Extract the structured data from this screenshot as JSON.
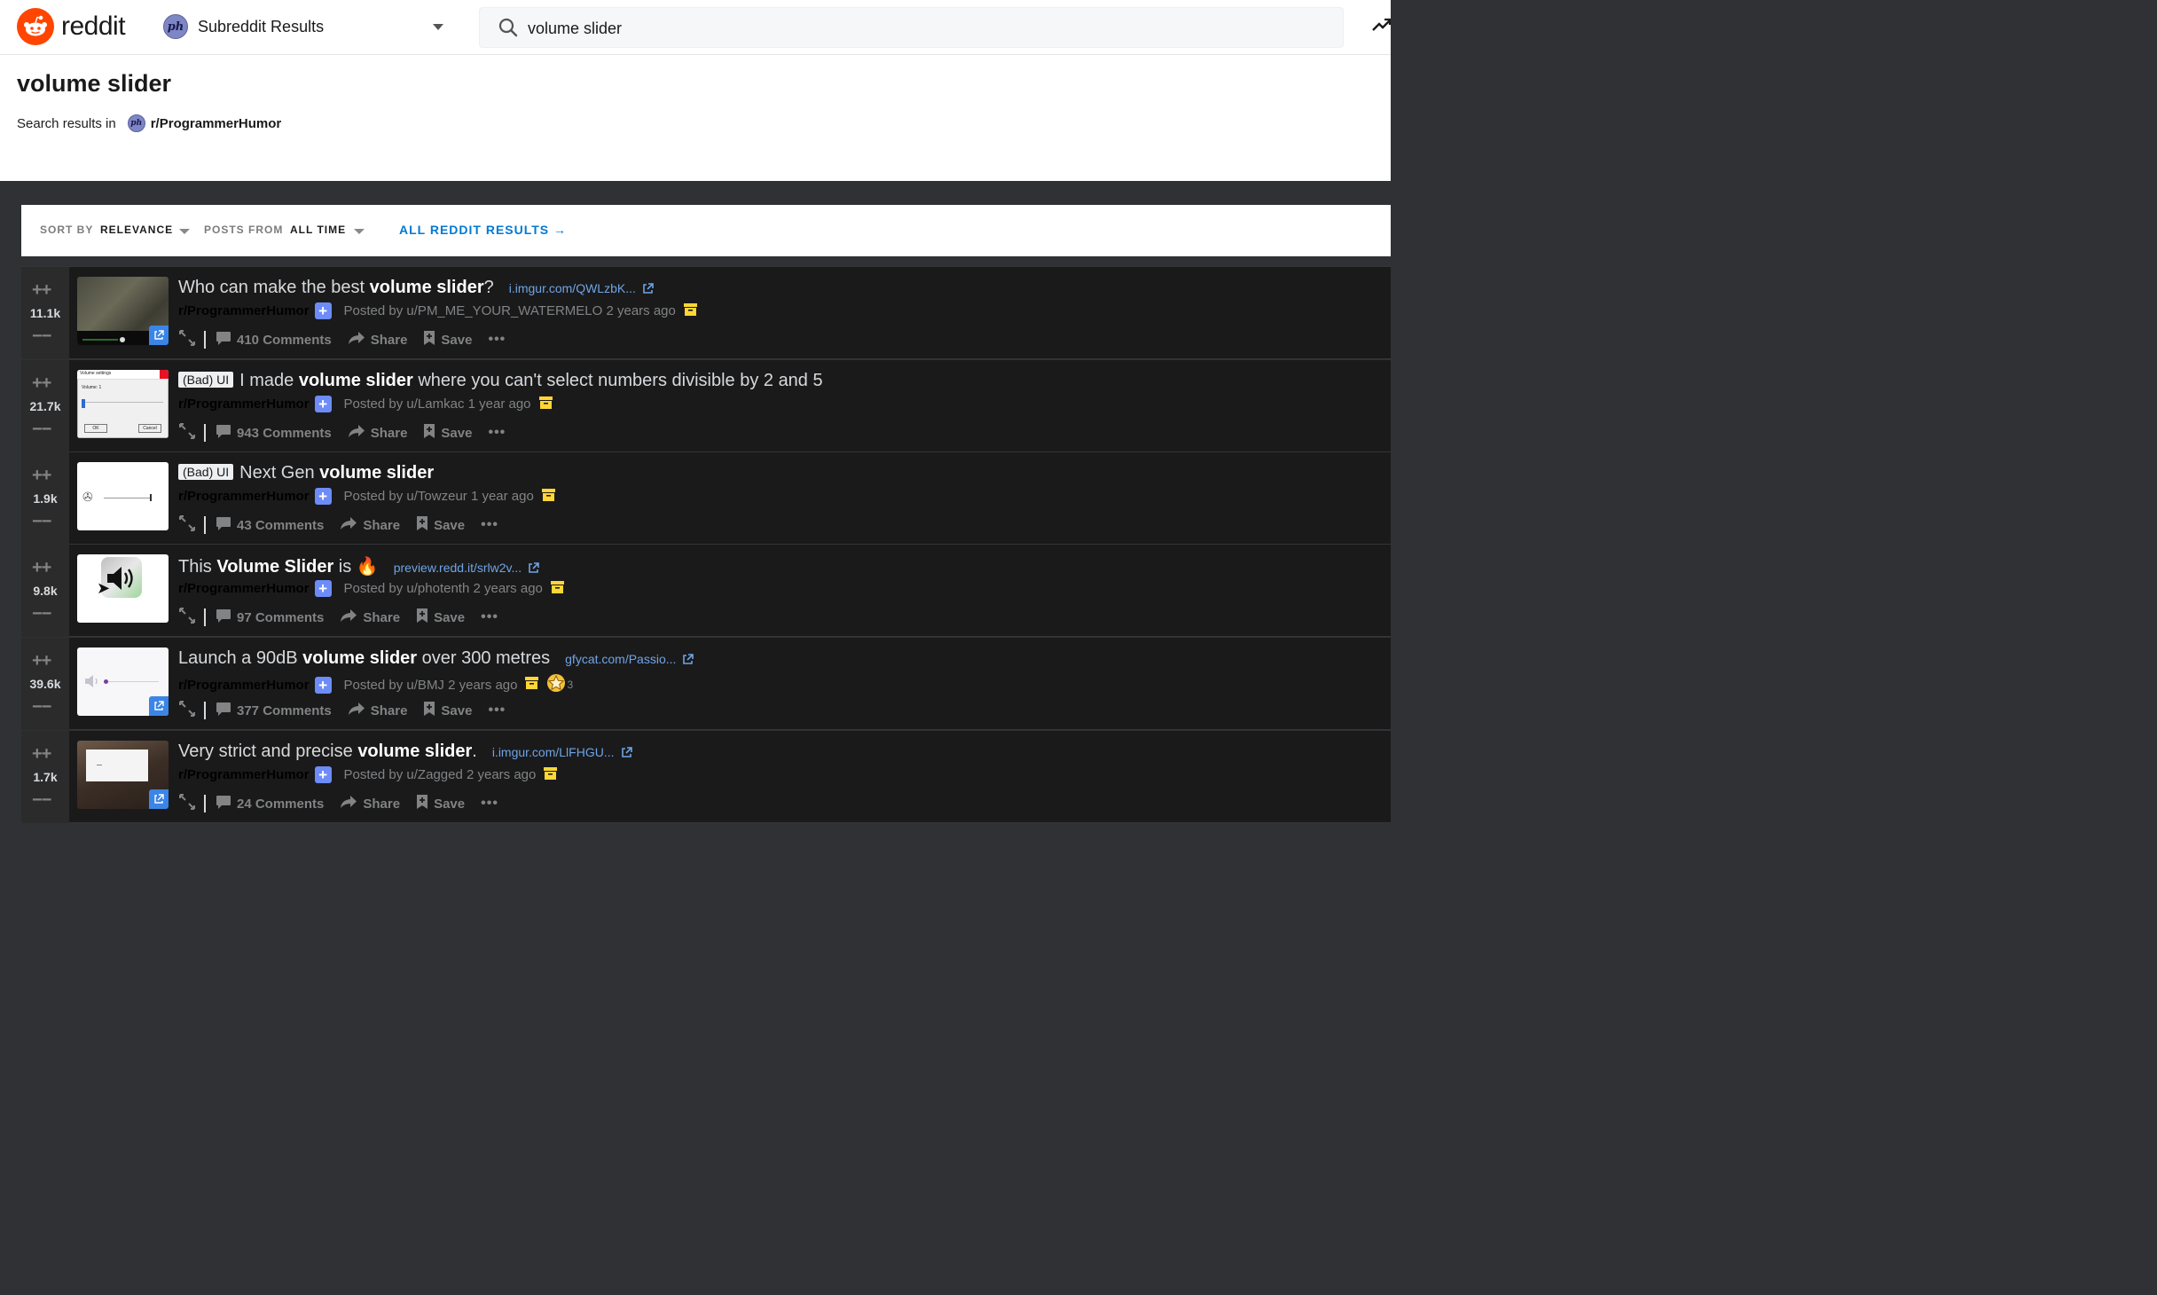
{
  "topbar": {
    "logo_text": "reddit",
    "community_avatar": "ph",
    "community_label": "Subreddit Results",
    "search_value": "volume slider",
    "search_icon": "magnifier",
    "trending_icon": "trending-up"
  },
  "header": {
    "title": "volume slider",
    "results_in_label": "Search results in",
    "subreddit_avatar": "ph",
    "subreddit": "r/ProgrammerHumor"
  },
  "filters": {
    "sort_label": "SORT BY",
    "sort_value": "RELEVANCE",
    "posts_from_label": "POSTS FROM",
    "posts_from_value": "ALL TIME",
    "all_results_link": "ALL REDDIT RESULTS →"
  },
  "colors": {
    "brand": "#ff4500",
    "link": "#0079d3",
    "join": "#6d8cf7",
    "archive": "#ffd635"
  },
  "posts": [
    {
      "score": "11.1k",
      "flair": "",
      "title_pre": "Who can make the best ",
      "title_bold": "volume slider",
      "title_post": "?",
      "domain": "i.imgur.com/QWLzbK...",
      "subreddit": "r/ProgrammerHumor",
      "posted": "Posted by u/PM_ME_YOUR_WATERMELO 2 years ago",
      "award_count": "",
      "comments": "410 Comments",
      "share": "Share",
      "save": "Save",
      "more": "•••"
    },
    {
      "score": "21.7k",
      "flair": "(Bad) UI",
      "title_pre": "I made ",
      "title_bold": "volume slider",
      "title_post": " where you can't select numbers divisible by 2 and 5",
      "domain": "",
      "subreddit": "r/ProgrammerHumor",
      "posted": "Posted by u/Lamkac 1 year ago",
      "award_count": "",
      "comments": "943 Comments",
      "share": "Share",
      "save": "Save",
      "more": "•••",
      "thumb_text": {
        "heading": "Volume settings",
        "volume": "Volume: 1",
        "ok": "OK",
        "cancel": "Cancel"
      }
    },
    {
      "score": "1.9k",
      "flair": "(Bad) UI",
      "title_pre": "Next Gen ",
      "title_bold": "volume slider",
      "title_post": "",
      "domain": "",
      "subreddit": "r/ProgrammerHumor",
      "posted": "Posted by u/Towzeur 1 year ago",
      "award_count": "",
      "comments": "43 Comments",
      "share": "Share",
      "save": "Save",
      "more": "•••"
    },
    {
      "score": "9.8k",
      "flair": "",
      "title_pre": "This ",
      "title_bold": "Volume Slider",
      "title_post": " is 🔥",
      "domain": "preview.redd.it/srlw2v...",
      "subreddit": "r/ProgrammerHumor",
      "posted": "Posted by u/photenth 2 years ago",
      "award_count": "",
      "comments": "97 Comments",
      "share": "Share",
      "save": "Save",
      "more": "•••"
    },
    {
      "score": "39.6k",
      "flair": "",
      "title_pre": "Launch a 90dB ",
      "title_bold": "volume slider",
      "title_post": " over 300 metres",
      "domain": "gfycat.com/Passio...",
      "subreddit": "r/ProgrammerHumor",
      "posted": "Posted by u/BMJ 2 years ago",
      "award_count": "3",
      "comments": "377 Comments",
      "share": "Share",
      "save": "Save",
      "more": "•••"
    },
    {
      "score": "1.7k",
      "flair": "",
      "title_pre": "Very strict and precise ",
      "title_bold": "volume slider",
      "title_post": ".",
      "domain": "i.imgur.com/LlFHGU...",
      "subreddit": "r/ProgrammerHumor",
      "posted": "Posted by u/Zagged 2 years ago",
      "award_count": "",
      "comments": "24 Comments",
      "share": "Share",
      "save": "Save",
      "more": "•••"
    }
  ]
}
